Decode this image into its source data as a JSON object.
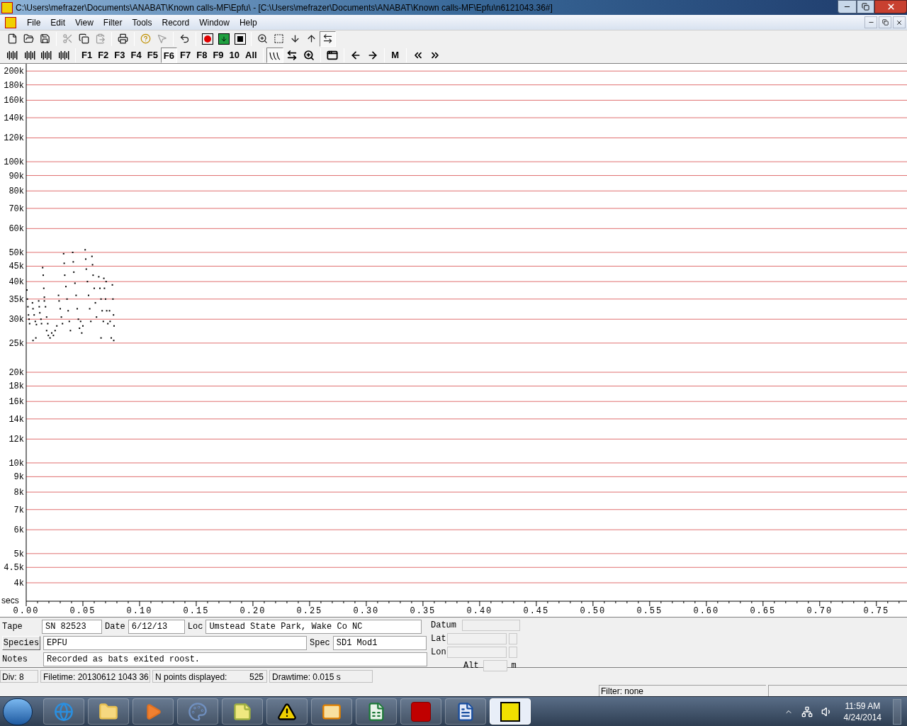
{
  "window": {
    "title": "C:\\Users\\mefrazer\\Documents\\ANABAT\\Known calls-MF\\Epfu\\ - [C:\\Users\\mefrazer\\Documents\\ANABAT\\Known calls-MF\\Epfu\\n6121043.36#]"
  },
  "menu": [
    "File",
    "Edit",
    "View",
    "Filter",
    "Tools",
    "Record",
    "Window",
    "Help"
  ],
  "toolbar_1": [
    {
      "kind": "new",
      "disabled": false
    },
    {
      "kind": "open",
      "disabled": false
    },
    {
      "kind": "save",
      "disabled": false
    },
    {
      "kind": "separator"
    },
    {
      "kind": "cut",
      "disabled": true
    },
    {
      "kind": "copy",
      "disabled": false
    },
    {
      "kind": "paste",
      "disabled": true
    },
    {
      "kind": "separator"
    },
    {
      "kind": "print",
      "disabled": false
    },
    {
      "kind": "separator"
    },
    {
      "kind": "help",
      "disabled": false
    },
    {
      "kind": "pointer-help",
      "disabled": true
    },
    {
      "kind": "separator"
    },
    {
      "kind": "undo",
      "disabled": false
    },
    {
      "kind": "separator"
    },
    {
      "kind": "record",
      "disabled": false
    },
    {
      "kind": "monitor",
      "disabled": false
    },
    {
      "kind": "stop",
      "disabled": false
    },
    {
      "kind": "separator"
    },
    {
      "kind": "zoom",
      "disabled": false
    },
    {
      "kind": "select",
      "disabled": false
    },
    {
      "kind": "down",
      "disabled": false
    },
    {
      "kind": "up",
      "disabled": false
    },
    {
      "kind": "scroll",
      "disabled": false,
      "selected": true
    }
  ],
  "toolbar_2": [
    {
      "kind": "bars",
      "selected": false
    },
    {
      "kind": "bars",
      "selected": false
    },
    {
      "kind": "bars",
      "selected": false
    },
    {
      "kind": "bars",
      "selected": false
    },
    {
      "kind": "separator"
    },
    {
      "kind": "key",
      "label": "F1",
      "selected": false
    },
    {
      "kind": "key",
      "label": "F2",
      "selected": false
    },
    {
      "kind": "key",
      "label": "F3",
      "selected": false
    },
    {
      "kind": "key",
      "label": "F4",
      "selected": false
    },
    {
      "kind": "key",
      "label": "F5",
      "selected": false
    },
    {
      "kind": "key",
      "label": "F6",
      "selected": true
    },
    {
      "kind": "key",
      "label": "F7",
      "selected": false
    },
    {
      "kind": "key",
      "label": "F8",
      "selected": false
    },
    {
      "kind": "key",
      "label": "F9",
      "selected": false
    },
    {
      "kind": "key",
      "label": "10",
      "selected": false
    },
    {
      "kind": "key",
      "label": "All",
      "selected": false
    },
    {
      "kind": "separator"
    },
    {
      "kind": "wave",
      "selected": true
    },
    {
      "kind": "fit",
      "selected": false
    },
    {
      "kind": "zoom",
      "selected": false
    },
    {
      "kind": "separator"
    },
    {
      "kind": "window",
      "selected": false
    },
    {
      "kind": "separator"
    },
    {
      "kind": "left",
      "selected": false
    },
    {
      "kind": "right",
      "selected": false
    },
    {
      "kind": "separator"
    },
    {
      "kind": "key",
      "label": "M",
      "selected": false
    },
    {
      "kind": "separator"
    },
    {
      "kind": "rewind",
      "selected": false
    },
    {
      "kind": "forward",
      "selected": false
    }
  ],
  "plot": {
    "x_axis_title": "secs",
    "x_labels": [
      "0.00",
      "0.05",
      "0.10",
      "0.15",
      "0.20",
      "0.25",
      "0.30",
      "0.35",
      "0.40",
      "0.45",
      "0.50",
      "0.55",
      "0.60",
      "0.65",
      "0.70",
      "0.75"
    ],
    "y_labels": [
      "200k",
      "180k",
      "160k",
      "140k",
      "120k",
      "100k",
      "90k",
      "80k",
      "70k",
      "60k",
      "50k",
      "45k",
      "40k",
      "35k",
      "30k",
      "25k",
      "20k",
      "18k",
      "16k",
      "14k",
      "12k",
      "10k",
      "9k",
      "8k",
      "7k",
      "6k",
      "5k",
      "4.5k",
      "4k"
    ]
  },
  "info": {
    "tape_label": "Tape",
    "tape": "SN 82523",
    "date_label": "Date",
    "date": "6/12/13",
    "loc_label": "Loc",
    "loc": "Umstead State Park, Wake Co NC",
    "species_button": "Species",
    "species": "EPFU",
    "spec_label": "Spec",
    "spec": "SD1 Mod1",
    "notes_label": "Notes",
    "notes": "Recorded as bats exited roost.",
    "datum_label": "Datum",
    "lat_label": "Lat",
    "lon_label": "Lon",
    "alt_label": "Alt",
    "alt_unit": "m"
  },
  "status_bar": {
    "div": "Div: 8",
    "filetime": "Filetime: 20130612 1043 36",
    "points_label": "N points displayed:",
    "points": "525",
    "drawtime": "Drawtime: 0.015 s",
    "filter": "Filter: none"
  },
  "taskbar": {
    "apps": [
      {
        "kind": "ie",
        "selected": false
      },
      {
        "kind": "explorer",
        "selected": false
      },
      {
        "kind": "media",
        "selected": false
      },
      {
        "kind": "paint",
        "selected": false
      },
      {
        "kind": "notes",
        "selected": false
      },
      {
        "kind": "warning",
        "selected": false
      },
      {
        "kind": "outlook",
        "selected": false
      },
      {
        "kind": "excel",
        "selected": false
      },
      {
        "kind": "acrobat",
        "selected": false
      },
      {
        "kind": "word",
        "selected": false
      },
      {
        "kind": "anabat",
        "selected": true
      }
    ],
    "time": "11:59 AM",
    "date": "4/24/2014"
  }
}
